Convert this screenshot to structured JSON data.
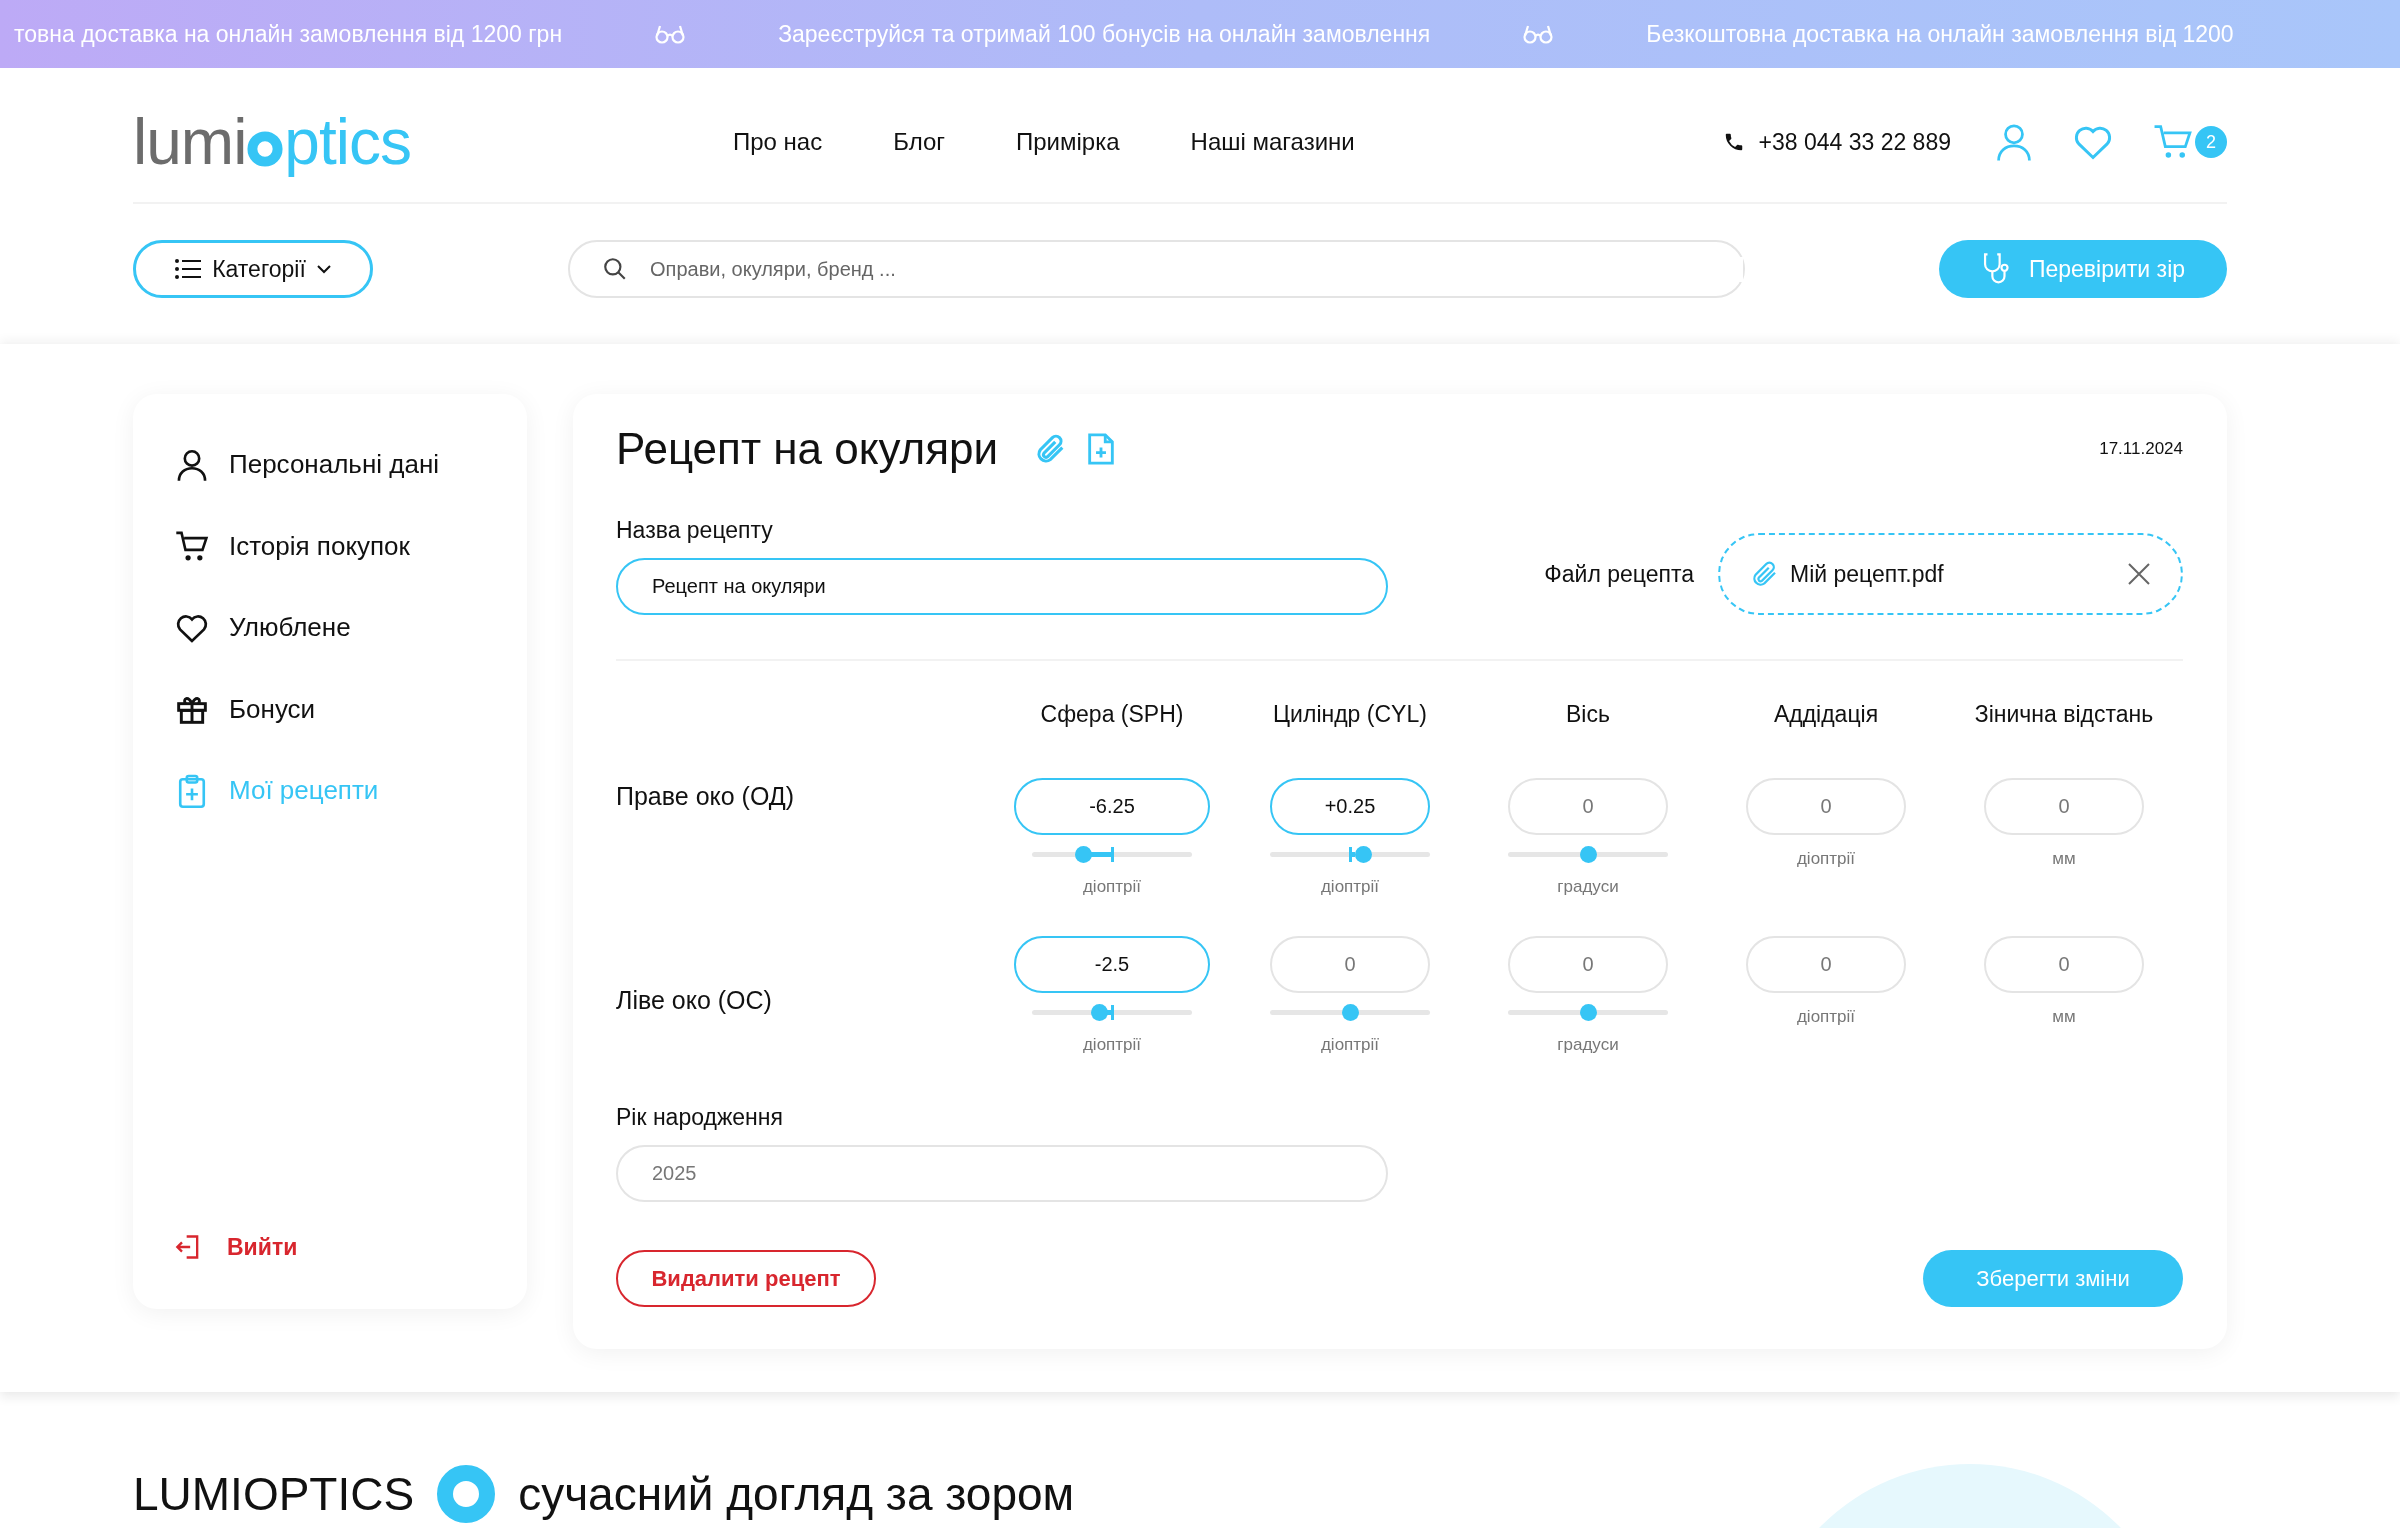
{
  "promo_bar": [
    "товна доставка на онлайн замовлення від 1200 грн",
    "Зареєструйся та отримай 100 бонусів на онлайн замовлення",
    "Безкоштовна доставка на онлайн замовлення від 1200"
  ],
  "header": {
    "logo": {
      "before": "lumi",
      "after": "ptics"
    },
    "nav": [
      "Про нас",
      "Блог",
      "Примірка",
      "Наші магазини"
    ],
    "phone": "+38 044 33 22 889",
    "cart_count": "2"
  },
  "toolbar": {
    "categories": "Категорії",
    "search": {
      "placeholder": "Оправи, окуляри, бренд ..."
    },
    "check_button": "Перевірити зір"
  },
  "sidebar": {
    "items": [
      {
        "label": "Персональні дані",
        "selected": false
      },
      {
        "label": "Історія покупок",
        "selected": false
      },
      {
        "label": "Улюблене",
        "selected": false
      },
      {
        "label": "Бонуси",
        "selected": false
      },
      {
        "label": "Мої рецепти",
        "selected": true
      }
    ],
    "logout": "Вийти"
  },
  "form": {
    "title": "Рецепт на окуляри",
    "date": "17.11.2024",
    "name_label": "Назва рецепту",
    "name_value": "Рецепт на окуляри",
    "file_label": "Файл рецепта",
    "file_name": "Мій рецепт.pdf",
    "columns": [
      "Сфера (SPH)",
      "Циліндр (CYL)",
      "Вісь",
      "Аддідація",
      "Зінична відстань"
    ],
    "rows": [
      {
        "label": "Праве око (ОД)",
        "cells": [
          {
            "value": "-6.25",
            "active": true,
            "level": 0.32,
            "unit": "діоптрії"
          },
          {
            "value": "+0.25",
            "active": true,
            "level": 0.58,
            "unit": "діоптрії"
          },
          {
            "value": "0",
            "active": false,
            "level": 0.5,
            "unit": "градуси"
          },
          {
            "value": "0",
            "active": false,
            "unit": "діоптрії"
          },
          {
            "value": "0",
            "active": false,
            "unit": "мм"
          }
        ]
      },
      {
        "label": "Ліве око (ОС)",
        "cells": [
          {
            "value": "-2.5",
            "active": true,
            "level": 0.42,
            "unit": "діоптрії"
          },
          {
            "value": "0",
            "active": false,
            "level": 0.5,
            "unit": "діоптрії"
          },
          {
            "value": "0",
            "active": false,
            "level": 0.5,
            "unit": "градуси"
          },
          {
            "value": "0",
            "active": false,
            "unit": "діоптрії"
          },
          {
            "value": "0",
            "active": false,
            "unit": "мм"
          }
        ]
      }
    ],
    "birth_label": "Рік народження",
    "birth_value": "2025",
    "delete_button": "Видалити рецепт",
    "save_button": "Зберегти зміни"
  },
  "about": {
    "before": "LUMIOPTICS",
    "after": "сучасний догляд за зором"
  }
}
